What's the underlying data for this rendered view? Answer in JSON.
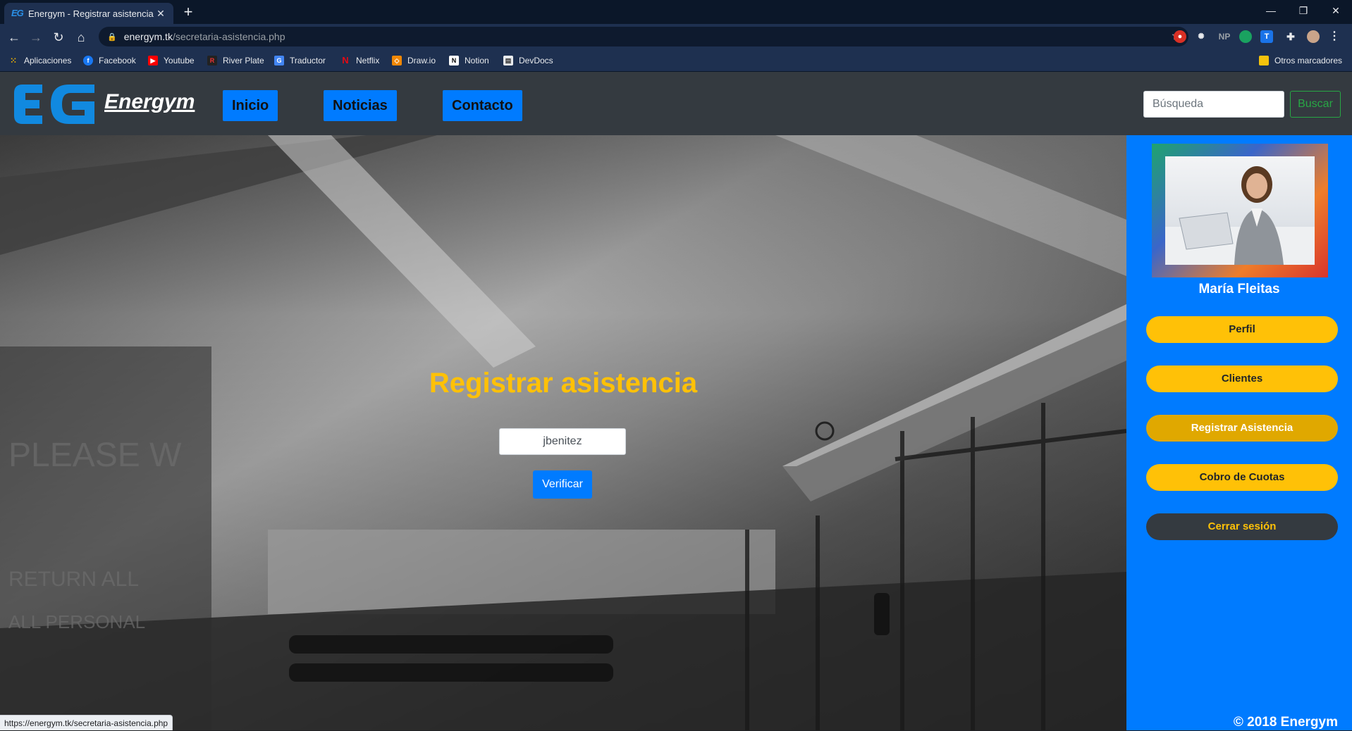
{
  "browser": {
    "tab_title": "Energym - Registrar asistencia",
    "url_host": "energym.tk",
    "url_path": "/secretaria-asistencia.php",
    "status_url": "https://energym.tk/secretaria-asistencia.php",
    "bookmarks": [
      {
        "label": "Aplicaciones",
        "icon": "apps-grid-icon"
      },
      {
        "label": "Facebook",
        "icon": "facebook-icon"
      },
      {
        "label": "Youtube",
        "icon": "youtube-icon"
      },
      {
        "label": "River Plate",
        "icon": "river-plate-icon"
      },
      {
        "label": "Traductor",
        "icon": "translate-icon"
      },
      {
        "label": "Netflix",
        "icon": "netflix-icon"
      },
      {
        "label": "Draw.io",
        "icon": "drawio-icon"
      },
      {
        "label": "Notion",
        "icon": "notion-icon"
      },
      {
        "label": "DevDocs",
        "icon": "devdocs-icon"
      }
    ],
    "other_bookmarks": "Otros marcadores",
    "extension_np": "NP"
  },
  "site": {
    "logo_text": "EG",
    "brand": "Energym",
    "nav": [
      {
        "label": "Inicio"
      },
      {
        "label": "Noticias"
      },
      {
        "label": "Contacto"
      }
    ],
    "search_placeholder": "Búsqueda",
    "search_button": "Buscar"
  },
  "main": {
    "title": "Registrar asistencia",
    "username_value": "jbenitez",
    "verify_button": "Verificar"
  },
  "sidebar": {
    "user_name": "María Fleitas",
    "menu": [
      {
        "label": "Perfil",
        "state": "normal"
      },
      {
        "label": "Clientes",
        "state": "normal"
      },
      {
        "label": "Registrar Asistencia",
        "state": "active"
      },
      {
        "label": "Cobro de Cuotas",
        "state": "normal"
      },
      {
        "label": "Cerrar sesión",
        "state": "logout"
      }
    ],
    "copyright": "© 2018 Energym"
  },
  "colors": {
    "primary": "#007bff",
    "warning": "#ffc107",
    "dark": "#343a40",
    "success": "#28a745"
  }
}
